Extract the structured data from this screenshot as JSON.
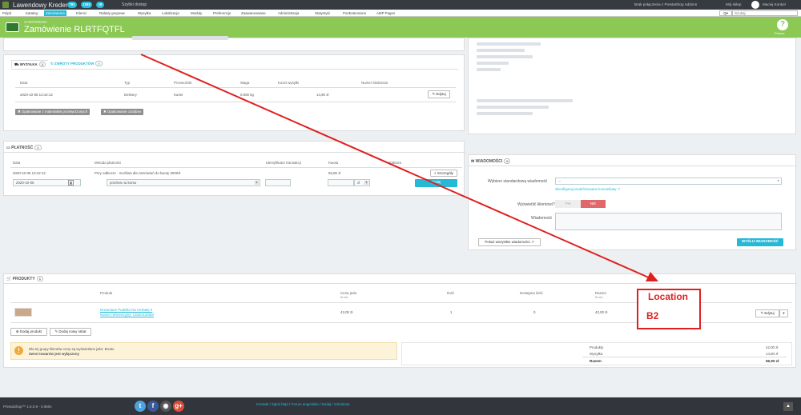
{
  "topbar": {
    "brand": "Lawendowy Kredens",
    "badges": [
      "781",
      "1262",
      "18"
    ],
    "quick_access": "Szybki dostęp",
    "addons_status": "Brak połączenia z PrestaShop Addons",
    "my_shop": "Mój sklep",
    "user": "Maciej Konkol"
  },
  "nav": {
    "items": [
      "Pulpit",
      "Katalog",
      "Zamówienia",
      "Klienci",
      "Rabaty grupowe",
      "Wysyłka",
      "Lokalizacja",
      "Moduły",
      "Preferencje",
      "Zaawansowane",
      "Administracja",
      "Statystyki",
      "PosExtensions",
      "AMP Pages"
    ],
    "active_index": 2,
    "search_label": "Q",
    "search_placeholder": "Szukaj"
  },
  "header": {
    "breadcrumb": "ZAMÓWIENIA",
    "title": "Zamówienie RLRTFQTFL",
    "help_label": "Pomoc"
  },
  "shipping": {
    "tab_shipping": "WYSYŁKA",
    "tab_shipping_count": "1",
    "tab_returns": "ZWROTY PRODUKTÓW",
    "tab_returns_count": "0",
    "headers": [
      "Data",
      "Typ",
      "Przewoźnik",
      "Waga",
      "Koszt wysyłki",
      "Numer śledzenia"
    ],
    "row": [
      "2020-10-05 13:42:12",
      "Delivery",
      "Kurier",
      "0.000 kg",
      "14,90 zł",
      ""
    ],
    "edit_label": "Edytuj",
    "gift_wrap_recycled": "Opakowanie z materiałów przetworzonych",
    "gift_wrap": "Opakowanie ozdobne"
  },
  "payment": {
    "title": "PŁATNOŚĆ",
    "count": "1",
    "headers": [
      "Data",
      "Metoda płatności",
      "Identyfikator transakcji",
      "Kwota",
      "Faktura"
    ],
    "row": [
      "2020-10-05 13:42:12",
      "Przy odbiorze - możliwa dla zamówień do kwoty 3000zł",
      "",
      "56,80 zł",
      ""
    ],
    "details_label": "Szczegóły",
    "date_value": "2020-10-05",
    "method_value": "przelew na konto",
    "currency": "zł",
    "add_label": "Dodaj"
  },
  "messages": {
    "title": "WIADOMOŚCI",
    "count": "0",
    "choose_label": "Wybierz standardową wiadomość",
    "choose_value": "--",
    "configure_link": "Skonfiguruj predefiniowane komunikaty",
    "display_label": "Wyświetlić klientowi?",
    "yes": "TAK",
    "no": "NIE",
    "message_label": "Wiadomość",
    "show_all": "Pokaż wszystkie wiadomości",
    "send": "WYŚLIJ WIADOMOŚĆ"
  },
  "products": {
    "title": "PRODUKTY",
    "count": "1",
    "headers": [
      "Produkt",
      "Cena jedn.",
      "Ilość",
      "Dostępna ilość",
      "Razem"
    ],
    "subheader": "Brutto",
    "name": "Drewniane Pudełko Na Herbatę II",
    "ref": "Numer referencyjny: CDDH1300M",
    "price": "42,00 zł",
    "qty": "1",
    "available": "0",
    "total": "42,00 zł",
    "edit_label": "Edytuj",
    "add_product": "Dodaj produkt",
    "add_discount": "Dodaj nowy rabat",
    "note_line1": "Dla tej grupy klientów ceny są wyświetlane jako: Brutto",
    "note_line2": "Zwrot towarów jest wyłączony",
    "summary": [
      {
        "label": "Produkty",
        "value": "42,00 zł"
      },
      {
        "label": "Wysyłka",
        "value": "14,90 zł"
      },
      {
        "label": "Razem",
        "value": "56,90 zł"
      }
    ]
  },
  "annotation": {
    "title": "Location",
    "value": "B2",
    "color": "#e02020"
  },
  "footer": {
    "version": "PrestaShop™ 1.6.0.9 - 0.060s",
    "links": "Kontakt / Zgłoś błąd / Forum angielskie / Dodaj / Szkolenia"
  }
}
